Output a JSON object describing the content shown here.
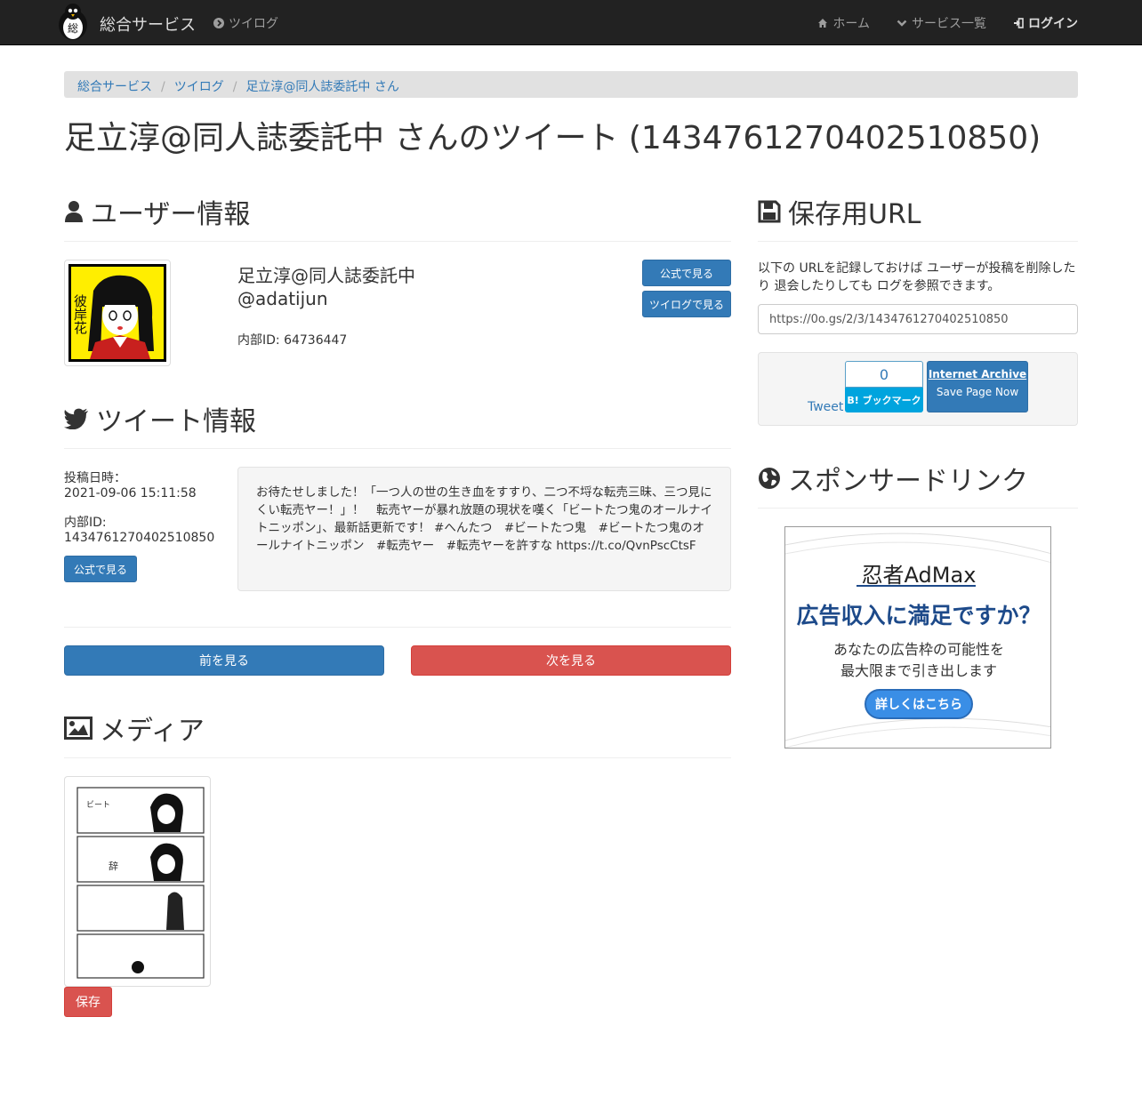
{
  "navbar": {
    "brand": "総合サービス",
    "logo_text": "総",
    "left_item": "ツイログ",
    "right_items": [
      "ホーム",
      "サービス一覧",
      "ログイン"
    ]
  },
  "breadcrumb": [
    "総合サービス",
    "ツイログ",
    "足立淳@同人誌委託中 さん"
  ],
  "page_title": "足立淳@同人誌委託中 さんのツイート (1434761270402510850)",
  "user_info": {
    "heading": "ユーザー情報",
    "avatar_text": "彼岸花",
    "name": "足立淳@同人誌委託中",
    "handle": "@adatijun",
    "internal_id": "内部ID: 64736447",
    "btn_official": "公式で見る",
    "btn_twilog": "ツイログで見る"
  },
  "tweet_info": {
    "heading": "ツイート情報",
    "posted_label": "投稿日時：",
    "posted_value": "2021-09-06 15:11:58",
    "id_label": "内部ID:",
    "id_value": "1434761270402510850",
    "btn_official": "公式で見る",
    "text": "お待たせしました！「一つ人の世の生き血をすすり、二つ不埒な転売三昧、三つ見にくい転売ヤー！」！　転売ヤーが暴れ放題の現状を嘆く「ビートたつ鬼のオールナイトニッポン」、最新話更新です！ #へんたつ　#ビートたつ鬼　#ビートたつ鬼のオールナイトニッポン　#転売ヤー　#転売ヤーを許すな https://t.co/QvnPscCtsF"
  },
  "pager": {
    "prev": "前を見る",
    "next": "次を見る"
  },
  "media": {
    "heading": "メディア",
    "save": "保存"
  },
  "save_url": {
    "heading": "保存用URL",
    "description": "以下の URLを記録しておけば ユーザーが投稿を削除したり 退会したりしても ログを参照できます。",
    "url": "https://0o.gs/2/3/1434761270402510850",
    "tweet": "Tweet",
    "hatena_count": "0",
    "hatena_label": "B! ブックマーク",
    "ia_title": "Internet Archive",
    "ia_sub": "Save Page Now"
  },
  "sponsor": {
    "heading": "スポンサードリンク",
    "ad_brand": "忍者AdMax",
    "ad_head": "広告収入に満足ですか？",
    "ad_line1": "あなたの広告枠の可能性を",
    "ad_line2": "最大限まで引き出します",
    "ad_button": "詳しくはこちら"
  },
  "colors": {
    "navbar": "#222222",
    "primary": "#337ab7",
    "danger": "#d9534f",
    "link": "#337ab7"
  }
}
